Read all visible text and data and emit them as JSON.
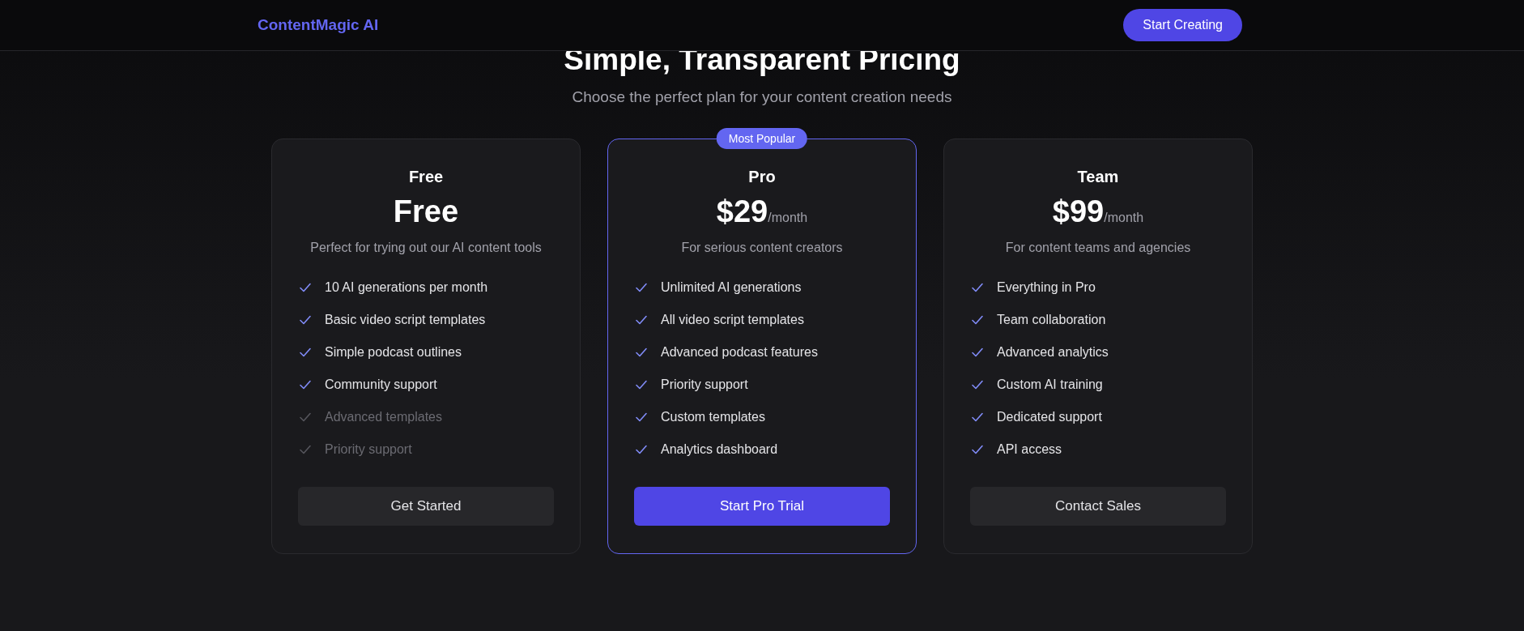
{
  "header": {
    "logo": "ContentMagic AI",
    "cta": "Start Creating"
  },
  "title": "Simple, Transparent Pricing",
  "subtitle": "Choose the perfect plan for your content creation needs",
  "plans": [
    {
      "name": "Free",
      "price": "Free",
      "description": "Perfect for trying out our AI content tools",
      "featured": false,
      "features": [
        {
          "text": "10 AI generations per month",
          "included": true
        },
        {
          "text": "Basic video script templates",
          "included": true
        },
        {
          "text": "Simple podcast outlines",
          "included": true
        },
        {
          "text": "Community support",
          "included": true
        },
        {
          "text": "Advanced templates",
          "included": false
        },
        {
          "text": "Priority support",
          "included": false
        }
      ],
      "button": "Get Started"
    },
    {
      "name": "Pro",
      "badge": "Most Popular",
      "price": "$29",
      "period": "/month",
      "description": "For serious content creators",
      "featured": true,
      "features": [
        {
          "text": "Unlimited AI generations",
          "included": true
        },
        {
          "text": "All video script templates",
          "included": true
        },
        {
          "text": "Advanced podcast features",
          "included": true
        },
        {
          "text": "Priority support",
          "included": true
        },
        {
          "text": "Custom templates",
          "included": true
        },
        {
          "text": "Analytics dashboard",
          "included": true
        }
      ],
      "button": "Start Pro Trial"
    },
    {
      "name": "Team",
      "price": "$99",
      "period": "/month",
      "description": "For content teams and agencies",
      "featured": false,
      "features": [
        {
          "text": "Everything in Pro",
          "included": true
        },
        {
          "text": "Team collaboration",
          "included": true
        },
        {
          "text": "Advanced analytics",
          "included": true
        },
        {
          "text": "Custom AI training",
          "included": true
        },
        {
          "text": "Dedicated support",
          "included": true
        },
        {
          "text": "API access",
          "included": true
        }
      ],
      "button": "Contact Sales"
    }
  ]
}
